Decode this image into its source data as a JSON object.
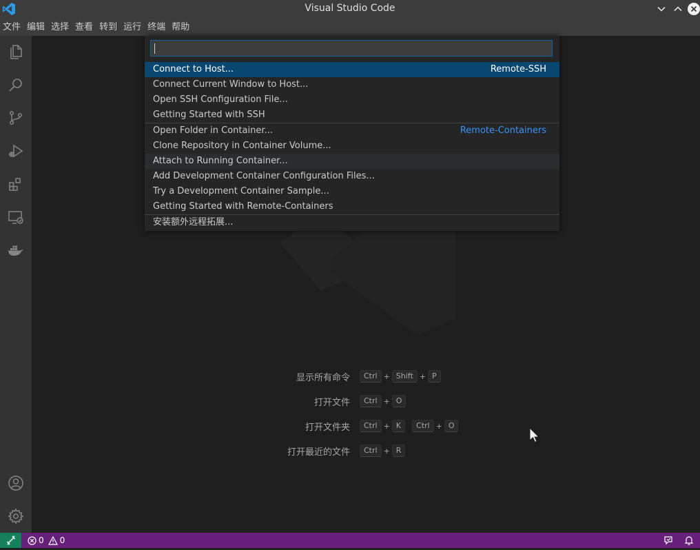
{
  "window": {
    "title": "Visual Studio Code"
  },
  "menu": {
    "items": [
      "文件",
      "编辑",
      "选择",
      "查看",
      "转到",
      "运行",
      "终端",
      "帮助"
    ]
  },
  "activity_bar": {
    "top": [
      "files-icon",
      "search-icon",
      "source-control-icon",
      "run-debug-icon",
      "extensions-icon",
      "remote-explorer-icon",
      "docker-icon"
    ],
    "bottom": [
      "accounts-icon",
      "gear-icon"
    ]
  },
  "quick_pick": {
    "input_value": "",
    "items": [
      {
        "label": "Connect to Host...",
        "group": "Remote-SSH",
        "state": "selected"
      },
      {
        "label": "Connect Current Window to Host...",
        "group": ""
      },
      {
        "label": "Open SSH Configuration File...",
        "group": ""
      },
      {
        "label": "Getting Started with SSH",
        "group": ""
      },
      {
        "label": "Open Folder in Container...",
        "group": "Remote-Containers"
      },
      {
        "label": "Clone Repository in Container Volume...",
        "group": ""
      },
      {
        "label": "Attach to Running Container...",
        "group": "",
        "state": "hover"
      },
      {
        "label": "Add Development Container Configuration Files...",
        "group": ""
      },
      {
        "label": "Try a Development Container Sample...",
        "group": ""
      },
      {
        "label": "Getting Started with Remote-Containers",
        "group": ""
      },
      {
        "label": "安装额外远程拓展...",
        "group": ""
      }
    ]
  },
  "shortcuts": [
    {
      "label": "显示所有命令",
      "keys": [
        "Ctrl",
        "+",
        "Shift",
        "+",
        "P"
      ]
    },
    {
      "label": "打开文件",
      "keys": [
        "Ctrl",
        "+",
        "O"
      ]
    },
    {
      "label": "打开文件夹",
      "keys": [
        "Ctrl",
        "+",
        "K",
        " ",
        "Ctrl",
        "+",
        "O"
      ]
    },
    {
      "label": "打开最近的文件",
      "keys": [
        "Ctrl",
        "+",
        "R"
      ]
    }
  ],
  "status_bar": {
    "errors": "0",
    "warnings": "0",
    "colors": {
      "background": "#68217a",
      "remote": "#16825d"
    }
  },
  "colors": {
    "accent": "#0e639c",
    "selected": "#094771",
    "group_label": "#3794ff"
  }
}
